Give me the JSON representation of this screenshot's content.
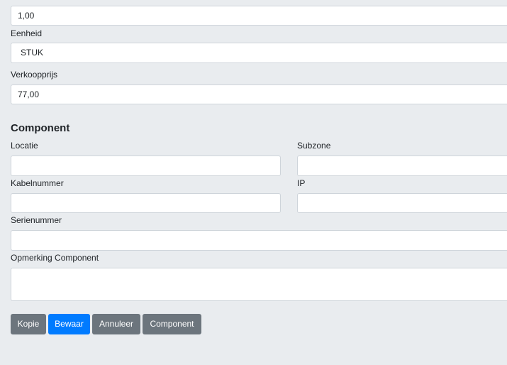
{
  "fields": {
    "quantity_value": "1,00",
    "unit_label": "Eenheid",
    "unit_value": "STUK",
    "price_label": "Verkoopprijs",
    "price_value": "77,00"
  },
  "component": {
    "heading": "Component",
    "location_label": "Locatie",
    "location_value": "",
    "subzone_label": "Subzone",
    "subzone_value": "",
    "cable_label": "Kabelnummer",
    "cable_value": "",
    "ip_label": "IP",
    "ip_value": "",
    "serial_label": "Serienummer",
    "serial_value": "",
    "remark_label": "Opmerking Component",
    "remark_value": ""
  },
  "buttons": {
    "copy": "Kopie",
    "save": "Bewaar",
    "cancel": "Annuleer",
    "component": "Component"
  },
  "colors": {
    "background": "#e9ecef",
    "primary": "#007bff",
    "secondary": "#6c757d"
  }
}
